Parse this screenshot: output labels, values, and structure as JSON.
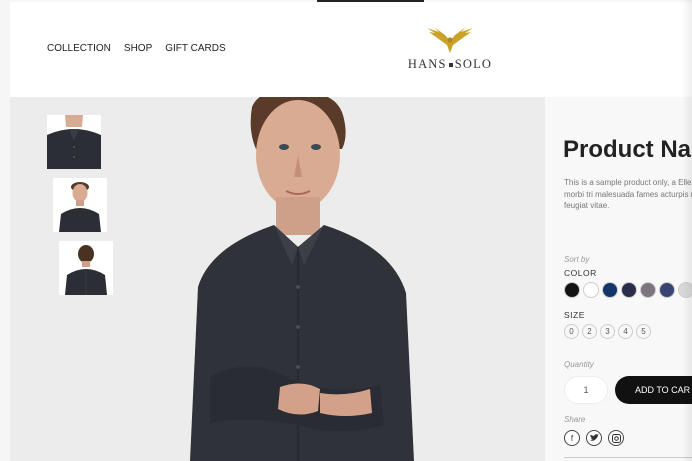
{
  "nav": {
    "items": [
      {
        "label": "COLLECTION"
      },
      {
        "label": "SHOP"
      },
      {
        "label": "GIFT CARDS"
      }
    ]
  },
  "brand": {
    "name_left": "HANS",
    "name_right": "SOLO",
    "accent_color": "#c9a227"
  },
  "product": {
    "title": "Product Nar",
    "description": "This is a sample product only, a Ellentesque habitant morbi tri malesuada fames acturpis not tortor quam, feugiat vitae.",
    "sort_label": "Sort by",
    "color_label": "COLOR",
    "colors": [
      "#141414",
      "#ffffff",
      "#12366b",
      "#2a2d4a",
      "#7e7480",
      "#384571",
      "#d9d9d9"
    ],
    "size_label": "SIZE",
    "sizes": [
      "0",
      "2",
      "3",
      "4",
      "5"
    ],
    "quantity_label": "Quantity",
    "quantity_value": "1",
    "add_to_cart": "ADD TO CAR",
    "share_label": "Share",
    "share_icons": [
      "facebook-icon",
      "twitter-icon",
      "instagram-icon"
    ]
  }
}
